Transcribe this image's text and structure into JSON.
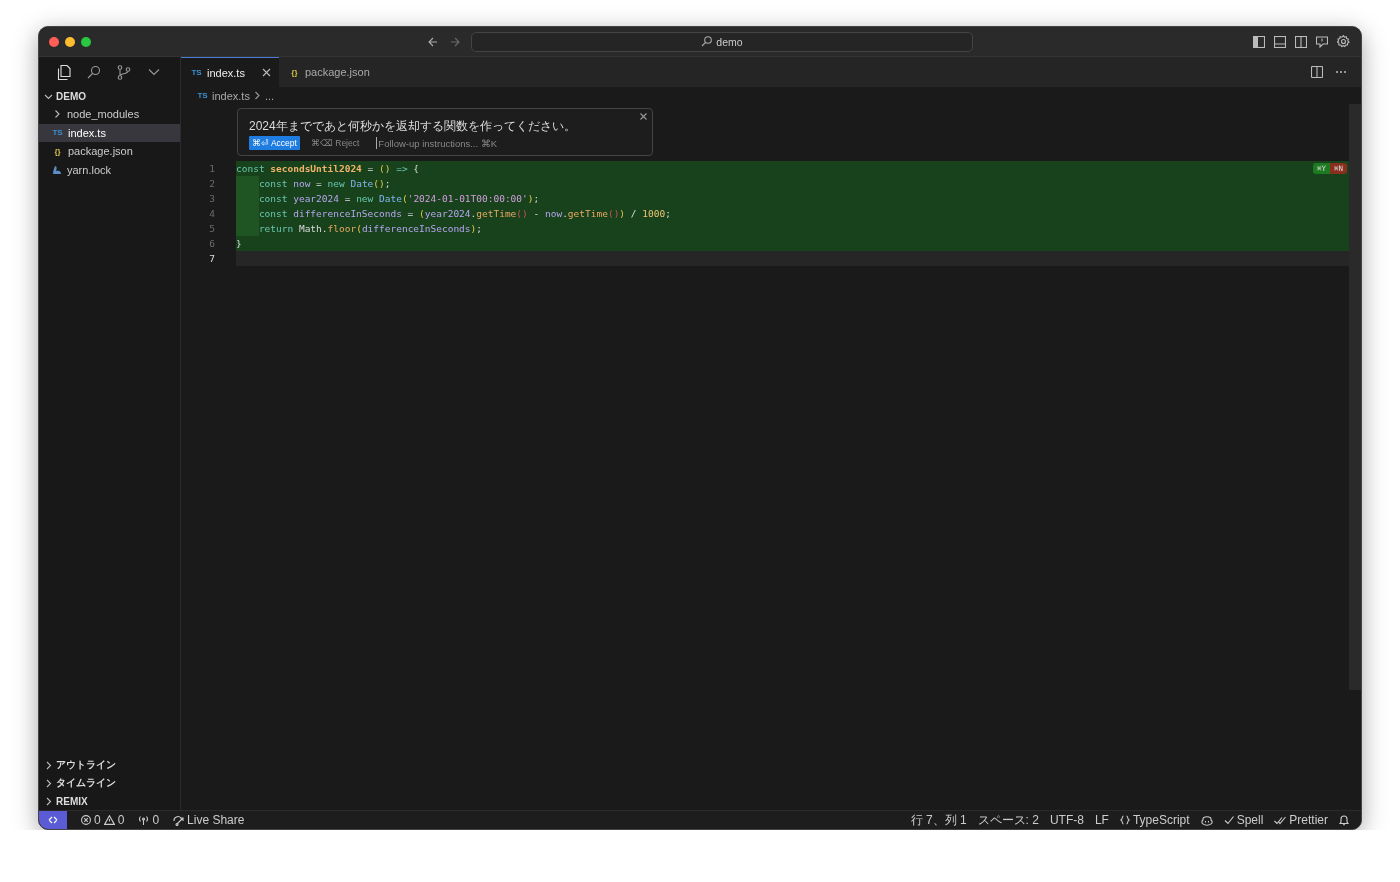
{
  "title_bar": {
    "search": "demo"
  },
  "sidebar": {
    "explorer": {
      "title": "DEMO",
      "expanded": true,
      "items": [
        {
          "kind": "folder",
          "label": "node_modules",
          "expanded": false,
          "selected": false
        },
        {
          "kind": "ts",
          "badge": "TS",
          "label": "index.ts",
          "selected": true
        },
        {
          "kind": "json",
          "badge": "{}",
          "label": "package.json",
          "selected": false
        },
        {
          "kind": "yarn",
          "label": "yarn.lock",
          "selected": false
        }
      ]
    },
    "sections": [
      {
        "label": "アウトライン",
        "expanded": false
      },
      {
        "label": "タイムライン",
        "expanded": false
      },
      {
        "label": "REMIX",
        "expanded": false
      }
    ]
  },
  "tabs": [
    {
      "kind": "ts",
      "badge": "TS",
      "label": "index.ts",
      "selected": true
    },
    {
      "kind": "json",
      "badge": "{}",
      "label": "package.json",
      "selected": false
    }
  ],
  "breadcrumb": {
    "badge": "TS",
    "file": "index.ts",
    "rest": "..."
  },
  "inline_prompt": {
    "text": "2024年までであと何秒かを返却する関数を作ってください。",
    "accept": "⌘⏎ Accept",
    "reject": "⌘⌫ Reject",
    "placeholder": "Follow-up instructions... ⌘K"
  },
  "diff_actions": {
    "accept": "⌘Y",
    "reject": "⌘N"
  },
  "code_lines": [
    {
      "number": "1",
      "added": true,
      "current": false,
      "indented": false,
      "tokens": [
        {
          "kind": "kw",
          "text": "const "
        },
        {
          "kind": "fn",
          "text": "secondsUntil2024"
        },
        {
          "kind": "plain",
          "text": " = "
        },
        {
          "kind": "paren",
          "text": "()"
        },
        {
          "kind": "kw",
          "text": " => "
        },
        {
          "kind": "plain",
          "text": "{"
        }
      ]
    },
    {
      "number": "2",
      "added": true,
      "current": false,
      "indented": true,
      "tokens": [
        {
          "kind": "kw",
          "text": "const "
        },
        {
          "kind": "var",
          "text": "now"
        },
        {
          "kind": "plain",
          "text": " = "
        },
        {
          "kind": "kw",
          "text": "new "
        },
        {
          "kind": "cls",
          "text": "Date"
        },
        {
          "kind": "paren",
          "text": "()"
        },
        {
          "kind": "plain",
          "text": ";"
        }
      ]
    },
    {
      "number": "3",
      "added": true,
      "current": false,
      "indented": true,
      "tokens": [
        {
          "kind": "kw",
          "text": "const "
        },
        {
          "kind": "var",
          "text": "year2024"
        },
        {
          "kind": "plain",
          "text": " = "
        },
        {
          "kind": "kw",
          "text": "new "
        },
        {
          "kind": "cls",
          "text": "Date"
        },
        {
          "kind": "paren",
          "text": "("
        },
        {
          "kind": "str",
          "text": "'2024-01-01T00:00:00'"
        },
        {
          "kind": "paren",
          "text": ")"
        },
        {
          "kind": "plain",
          "text": ";"
        }
      ]
    },
    {
      "number": "4",
      "added": true,
      "current": false,
      "indented": true,
      "tokens": [
        {
          "kind": "kw",
          "text": "const "
        },
        {
          "kind": "var",
          "text": "differenceInSeconds"
        },
        {
          "kind": "plain",
          "text": " = "
        },
        {
          "kind": "paren",
          "text": "("
        },
        {
          "kind": "var",
          "text": "year2024"
        },
        {
          "kind": "plain",
          "text": "."
        },
        {
          "kind": "method",
          "text": "getTime"
        },
        {
          "kind": "paren2",
          "text": "()"
        },
        {
          "kind": "plain",
          "text": " - "
        },
        {
          "kind": "var",
          "text": "now"
        },
        {
          "kind": "plain",
          "text": "."
        },
        {
          "kind": "method",
          "text": "getTime"
        },
        {
          "kind": "paren2",
          "text": "()"
        },
        {
          "kind": "paren",
          "text": ")"
        },
        {
          "kind": "plain",
          "text": " / "
        },
        {
          "kind": "num",
          "text": "1000"
        },
        {
          "kind": "plain",
          "text": ";"
        }
      ]
    },
    {
      "number": "5",
      "added": true,
      "current": false,
      "indented": true,
      "tokens": [
        {
          "kind": "kw",
          "text": "return "
        },
        {
          "kind": "plain",
          "text": "Math."
        },
        {
          "kind": "method",
          "text": "floor"
        },
        {
          "kind": "paren",
          "text": "("
        },
        {
          "kind": "var",
          "text": "differenceInSeconds"
        },
        {
          "kind": "paren",
          "text": ")"
        },
        {
          "kind": "plain",
          "text": ";"
        }
      ]
    },
    {
      "number": "6",
      "added": true,
      "current": false,
      "indented": false,
      "tokens": [
        {
          "kind": "plain",
          "text": "}"
        }
      ]
    },
    {
      "number": "7",
      "added": false,
      "current": true,
      "indented": false
    }
  ],
  "status_bar": {
    "left": [
      {
        "kind": "remote"
      },
      {
        "kind": "problems",
        "errors": "0",
        "warnings": "0"
      },
      {
        "kind": "ports",
        "text": "0"
      },
      {
        "kind": "liveshare",
        "text": "Live Share"
      }
    ],
    "right": [
      {
        "kind": "text",
        "text": "行 7、列 1"
      },
      {
        "kind": "text",
        "text": "スペース: 2"
      },
      {
        "kind": "text",
        "text": "UTF-8"
      },
      {
        "kind": "text",
        "text": "LF"
      },
      {
        "kind": "language",
        "text": "TypeScript"
      },
      {
        "kind": "copilot"
      },
      {
        "kind": "check",
        "text": "Spell"
      },
      {
        "kind": "doublecheck",
        "text": "Prettier"
      },
      {
        "kind": "bell"
      }
    ]
  }
}
